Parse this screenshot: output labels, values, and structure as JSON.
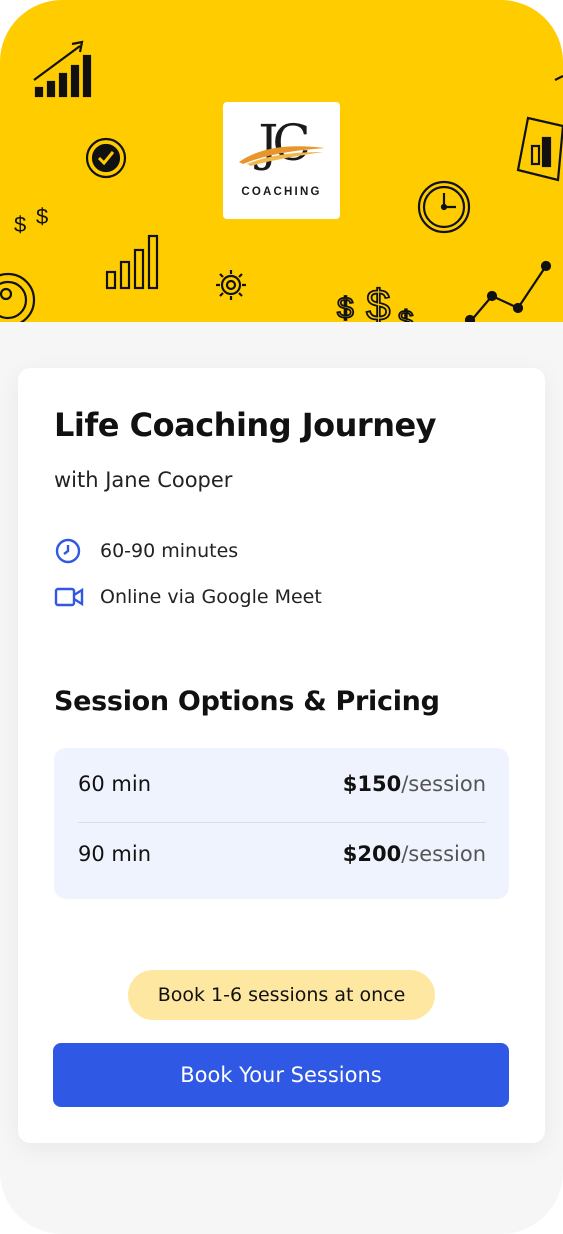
{
  "brand": {
    "monogram": "JC",
    "wordmark": "COACHING",
    "hero_color": "#ffcc00",
    "decorations": [
      "bar-chart-icon",
      "badge-check-icon",
      "dollar-icon",
      "gear-icon",
      "clock-icon",
      "line-chart-icon"
    ]
  },
  "card": {
    "title": "Life Coaching Journey",
    "coach": "with Jane Cooper",
    "details": [
      {
        "icon": "clock-icon",
        "text": "60-90 minutes"
      },
      {
        "icon": "video-camera-icon",
        "text": "Online via Google Meet"
      }
    ]
  },
  "pricing": {
    "title": "Session Options & Pricing",
    "options": [
      {
        "duration": "60 min",
        "price": "$150",
        "unit": "/session"
      },
      {
        "duration": "90 min",
        "price": "$200",
        "unit": "/session"
      }
    ]
  },
  "booking": {
    "note": "Book 1-6 sessions at once",
    "cta_label": "Book Your Sessions",
    "accent_color": "#2f58e4",
    "note_color": "#fde7a1"
  }
}
